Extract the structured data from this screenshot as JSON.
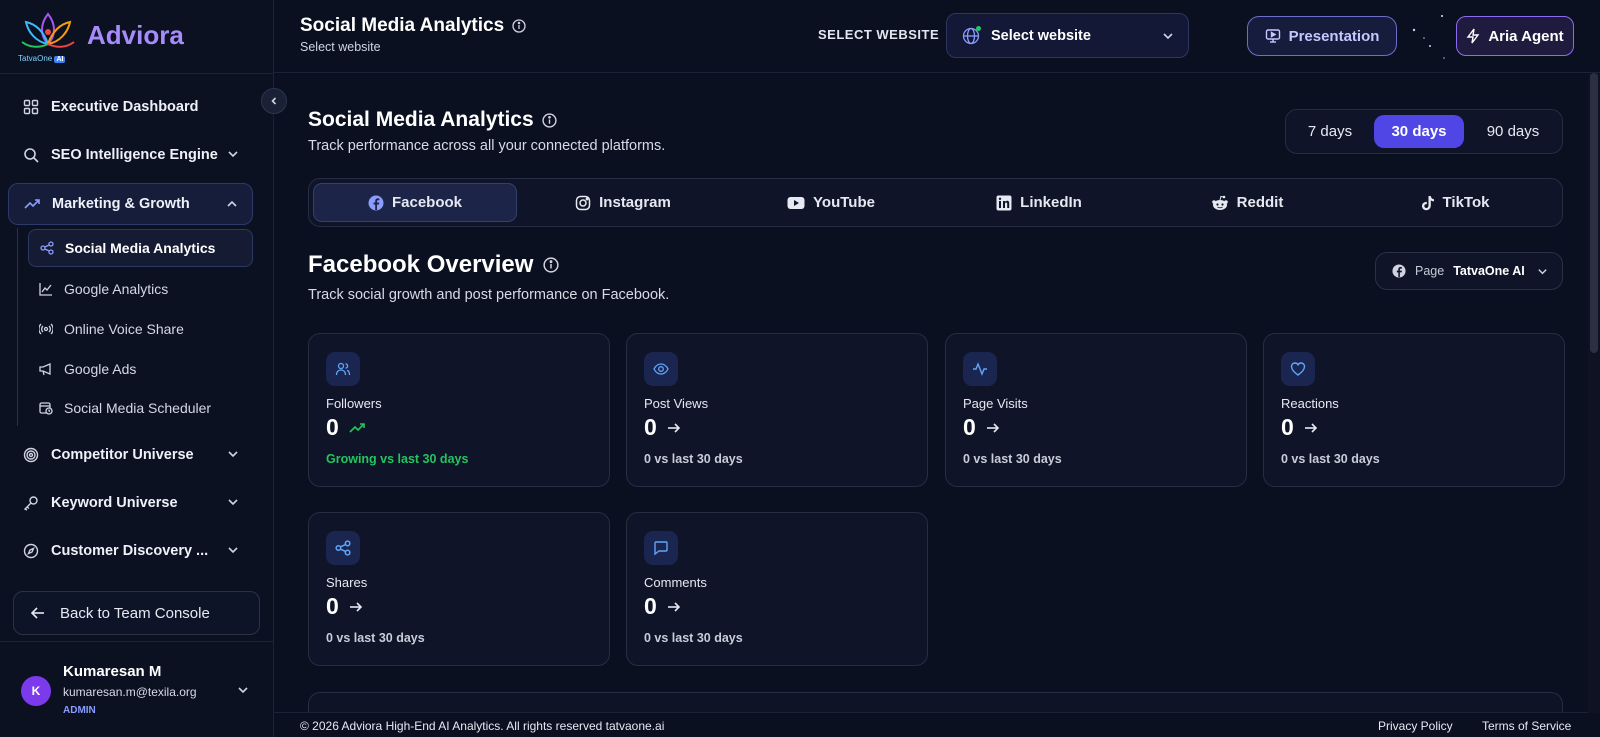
{
  "brand": {
    "name": "Adviora",
    "sub_prefix": "TatvaOne",
    "sub_badge": "AI"
  },
  "sidebar": {
    "items": [
      {
        "label": "Executive Dashboard",
        "icon": "grid-icon"
      },
      {
        "label": "SEO Intelligence Engine",
        "icon": "search-icon"
      },
      {
        "label": "Marketing & Growth",
        "icon": "trending-up-icon"
      },
      {
        "label": "Competitor Universe",
        "icon": "target-icon"
      },
      {
        "label": "Keyword Universe",
        "icon": "key-icon"
      },
      {
        "label": "Customer Discovery ...",
        "icon": "compass-icon"
      }
    ],
    "sub_items": [
      {
        "label": "Social Media Analytics",
        "icon": "share-icon"
      },
      {
        "label": "Google Analytics",
        "icon": "line-chart-icon"
      },
      {
        "label": "Online Voice Share",
        "icon": "broadcast-icon"
      },
      {
        "label": "Google Ads",
        "icon": "megaphone-icon"
      },
      {
        "label": "Social Media Scheduler",
        "icon": "calendar-clock-icon"
      }
    ],
    "back_label": "Back to Team Console"
  },
  "user": {
    "initial": "K",
    "name": "Kumaresan M",
    "email": "kumaresan.m@texila.org",
    "role": "ADMIN"
  },
  "topbar": {
    "title": "Social Media Analytics",
    "subtitle": "Select website",
    "select_label": "SELECT WEBSITE",
    "select_value": "Select website",
    "presentation_label": "Presentation",
    "aria_label": "Aria Agent"
  },
  "main": {
    "title": "Social Media Analytics",
    "subtitle": "Track performance across all your connected platforms.",
    "ranges": [
      {
        "label": "7 days",
        "active": false
      },
      {
        "label": "30 days",
        "active": true
      },
      {
        "label": "90 days",
        "active": false
      }
    ],
    "tabs": [
      "Facebook",
      "Instagram",
      "YouTube",
      "LinkedIn",
      "Reddit",
      "TikTok"
    ],
    "overview_title": "Facebook Overview",
    "overview_subtitle": "Track social growth and post performance on Facebook.",
    "page_select": {
      "label": "Page",
      "value": "TatvaOne AI"
    },
    "cards": [
      {
        "label": "Followers",
        "value": "0",
        "note": "Growing vs last 30 days",
        "icon": "users-icon",
        "trend": "up"
      },
      {
        "label": "Post Views",
        "value": "0",
        "note": "0 vs last 30 days",
        "icon": "eye-icon",
        "trend": "flat"
      },
      {
        "label": "Page Visits",
        "value": "0",
        "note": "0 vs last 30 days",
        "icon": "activity-icon",
        "trend": "flat"
      },
      {
        "label": "Reactions",
        "value": "0",
        "note": "0 vs last 30 days",
        "icon": "heart-icon",
        "trend": "flat"
      },
      {
        "label": "Shares",
        "value": "0",
        "note": "0 vs last 30 days",
        "icon": "share-icon",
        "trend": "flat"
      },
      {
        "label": "Comments",
        "value": "0",
        "note": "0 vs last 30 days",
        "icon": "message-icon",
        "trend": "flat"
      }
    ]
  },
  "footer": {
    "copyright": "© 2026 Adviora High-End AI Analytics. All rights reserved tatvaone.ai",
    "privacy": "Privacy Policy",
    "terms": "Terms of Service"
  },
  "colors": {
    "accent": "#4f46e5",
    "brand": "#a78bfa",
    "positive": "#22c55e",
    "background": "#0b1020"
  }
}
